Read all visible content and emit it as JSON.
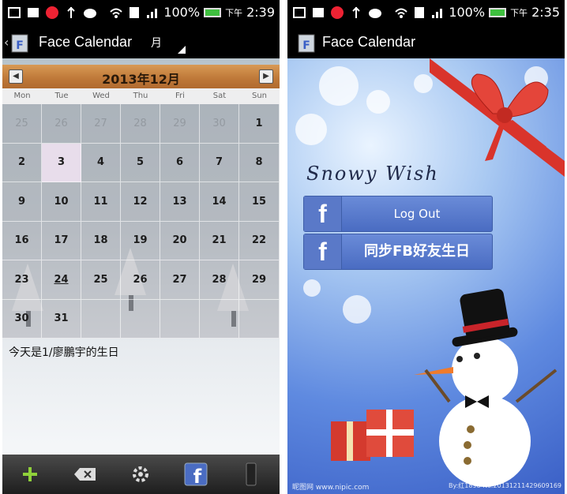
{
  "status_left": {
    "time": "2:39"
  },
  "status_right": {
    "time": "2:35"
  },
  "status_common": {
    "battery": "100%",
    "ampm": "下午"
  },
  "app": {
    "title": "Face Calendar",
    "view_mode": "月"
  },
  "calendar": {
    "month_title": "2013年12月",
    "weekdays": [
      "Mon",
      "Tue",
      "Wed",
      "Thu",
      "Fri",
      "Sat",
      "Sun"
    ],
    "rows": [
      [
        "25",
        "26",
        "27",
        "28",
        "29",
        "30",
        "1"
      ],
      [
        "2",
        "3",
        "4",
        "5",
        "6",
        "7",
        "8"
      ],
      [
        "9",
        "10",
        "11",
        "12",
        "13",
        "14",
        "15"
      ],
      [
        "16",
        "17",
        "18",
        "19",
        "20",
        "21",
        "22"
      ],
      [
        "23",
        "24",
        "25",
        "26",
        "27",
        "28",
        "29"
      ],
      [
        "30",
        "31",
        "",
        "",
        "",
        "",
        ""
      ]
    ],
    "today": "3",
    "underlined": "24"
  },
  "birthday_text": "今天是1/廖鵬宇的生日",
  "bottom_toolbar": [
    "add-icon",
    "delete-icon",
    "settings-icon",
    "facebook-icon",
    "phone-icon"
  ],
  "fb": {
    "greeting": "Snowy Wish",
    "logout_label": "Log Out",
    "sync_label": "同步FB好友生日",
    "icon_letter": "f"
  },
  "watermark": {
    "left": "昵图网 www.nipic.com",
    "right": "By:红1898 No.20131211429609169"
  },
  "colors": {
    "wood": "#c07a3a",
    "fb_blue": "#4a6cc2",
    "ribbon": "#d9342b"
  }
}
